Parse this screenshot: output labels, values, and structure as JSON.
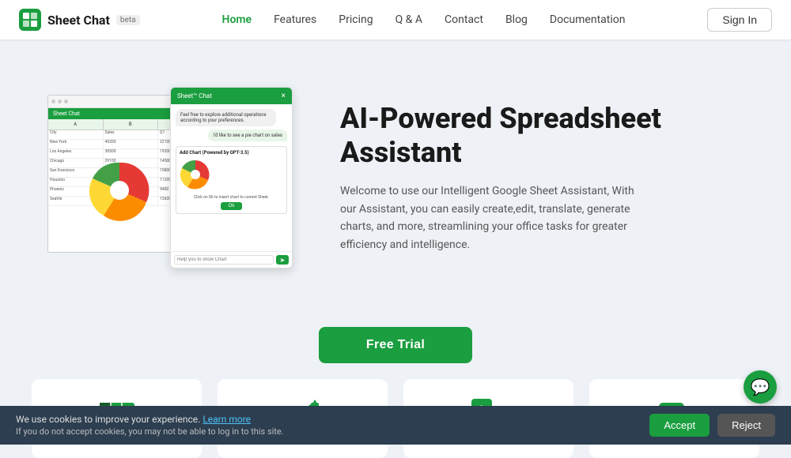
{
  "brand": {
    "name": "Sheet Chat",
    "beta_label": "beta"
  },
  "navbar": {
    "links": [
      {
        "label": "Home",
        "active": true
      },
      {
        "label": "Features",
        "active": false
      },
      {
        "label": "Pricing",
        "active": false
      },
      {
        "label": "Q & A",
        "active": false
      },
      {
        "label": "Contact",
        "active": false
      },
      {
        "label": "Blog",
        "active": false
      },
      {
        "label": "Documentation",
        "active": false
      }
    ],
    "signin_label": "Sign In"
  },
  "hero": {
    "title": "AI-Powered Spreadsheet Assistant",
    "description": "Welcome to use our Intelligent Google Sheet Assistant, With our Assistant, you can easily create,edit, translate, generate charts, and more, streamlining your office tasks for greater efficiency and intelligence.",
    "chat_header": "Sheet™ Chat",
    "chat_bubble1": "Feel free to explore additional operations according to your preferences.",
    "chat_bubble_user": "I'd like to see a pie chart on sales",
    "chat_confirm_title": "Add Chart (Powered by GPT-3.5)",
    "chat_confirm_text": "Click on Ok to insert chart to current Sheet.",
    "chat_ok_label": "Ok",
    "chat_input_placeholder": "Help you to show Chart",
    "chat_send_icon": "➤"
  },
  "cta": {
    "button_label": "Free Trial"
  },
  "features": [
    {
      "icon": "table",
      "color": "#1a9e3f"
    },
    {
      "icon": "chart",
      "color": "#1a9e3f"
    },
    {
      "icon": "translate",
      "color": "#1a9e3f"
    },
    {
      "icon": "chat",
      "color": "#1a9e3f"
    }
  ],
  "cookie": {
    "line1": "We use cookies to improve your experience.",
    "learn_more": "Learn more",
    "line2": "If you do not accept cookies, you may not be able to log in to this site.",
    "accept_label": "Accept",
    "reject_label": "Reject"
  }
}
